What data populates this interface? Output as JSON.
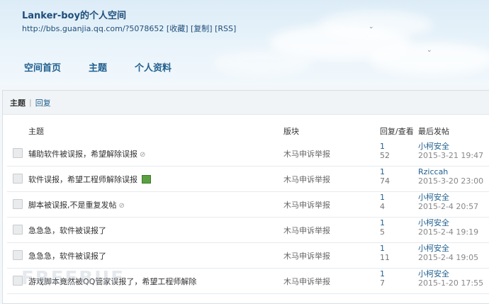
{
  "header": {
    "title": "Lanker-boy的个人空间",
    "url": "http://bbs.guanjia.qq.com/?5078652",
    "links": [
      "[收藏]",
      "[复制]",
      "[RSS]"
    ],
    "nav": [
      "空间首页",
      "主题",
      "个人资料"
    ]
  },
  "subtabs": {
    "active": "主题",
    "other": "回复"
  },
  "table": {
    "headers": {
      "topic": "主题",
      "board": "版块",
      "replies_views": "回复/查看",
      "last_post": "最后发帖"
    },
    "rows": [
      {
        "title": "辅助软件被误报，希望解除误报",
        "attach": "clip",
        "board": "木马申诉举报",
        "replies": "1",
        "views": "52",
        "user": "小柯安全",
        "time": "2015-3-21 19:47"
      },
      {
        "title": "软件误报，希望工程师解除误报",
        "attach": "image",
        "board": "木马申诉举报",
        "replies": "1",
        "views": "74",
        "user": "Rziccah",
        "time": "2015-3-20 23:00"
      },
      {
        "title": "脚本被误报,不是重复发帖",
        "attach": "clip",
        "board": "木马申诉举报",
        "replies": "1",
        "views": "4",
        "user": "小柯安全",
        "time": "2015-2-4 20:57"
      },
      {
        "title": "急急急，软件被误报了",
        "attach": "",
        "board": "木马申诉举报",
        "replies": "1",
        "views": "5",
        "user": "小柯安全",
        "time": "2015-2-4 19:19"
      },
      {
        "title": "急急急，软件被误报了",
        "attach": "",
        "board": "木马申诉举报",
        "replies": "1",
        "views": "11",
        "user": "小柯安全",
        "time": "2015-2-4 19:05"
      },
      {
        "title": "游戏脚本竟然被QQ管家误报了，希望工程师解除",
        "attach": "",
        "board": "木马申诉举报",
        "replies": "1",
        "views": "7",
        "user": "小柯安全",
        "time": "2015-1-20 17:55"
      }
    ]
  },
  "watermark": "FREEBUF"
}
